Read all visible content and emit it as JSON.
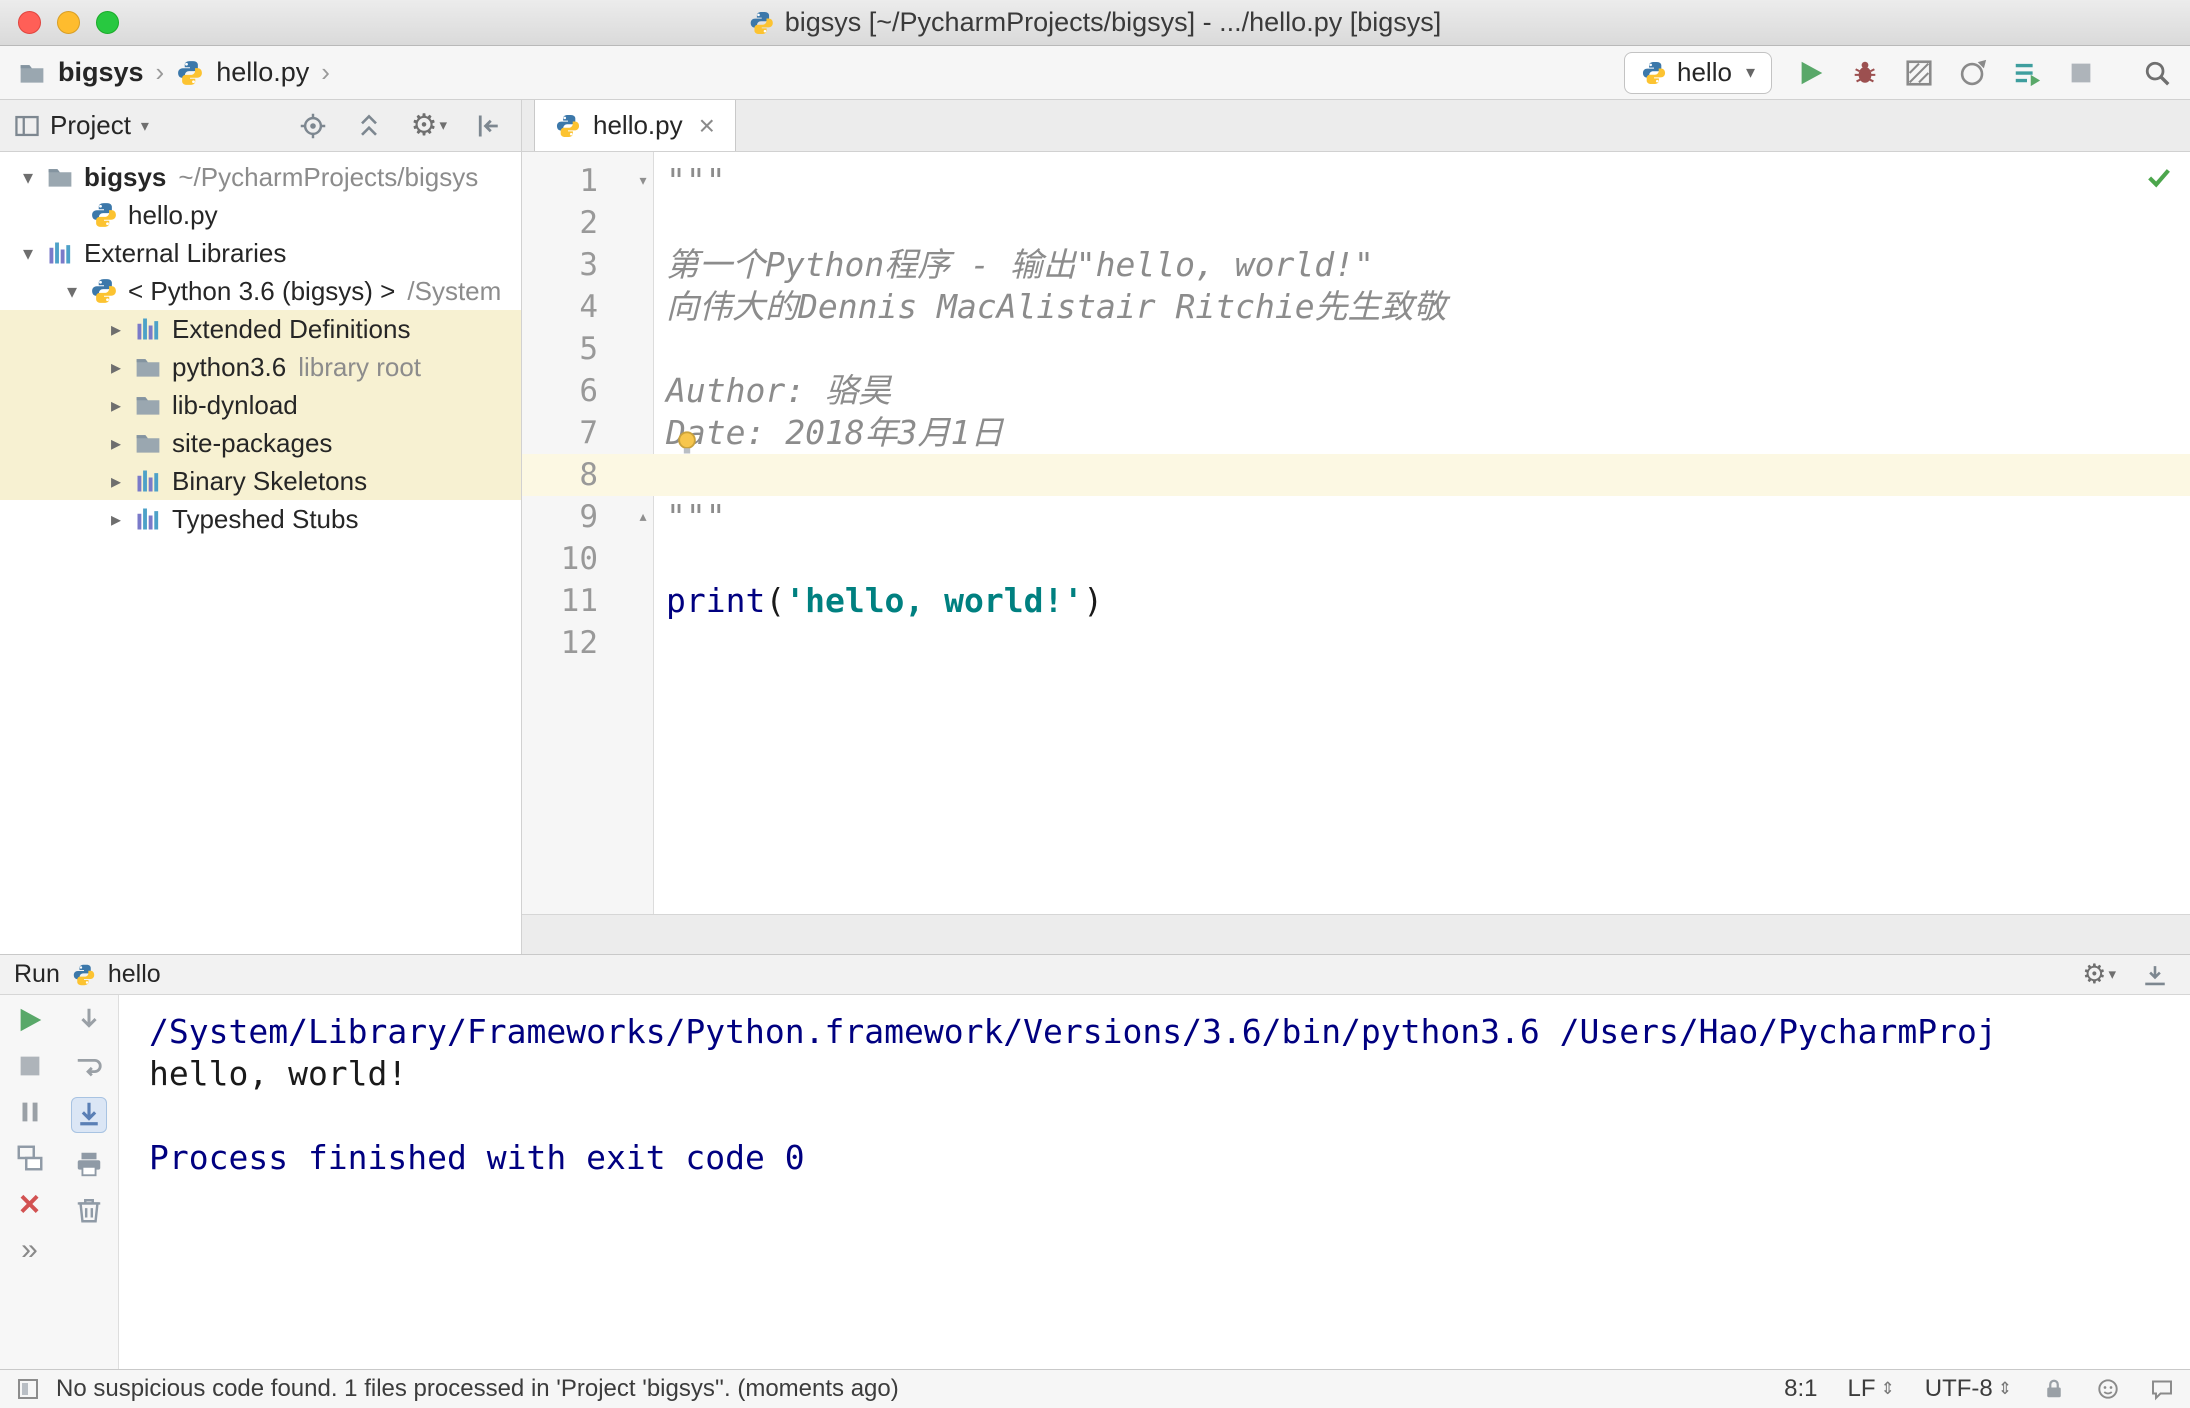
{
  "colors": {
    "run_green": "#59a869",
    "error_red": "#d25252",
    "library_highlight": "#f7f1d2",
    "caret_line": "#fcf8e3",
    "console_system": "#000080",
    "keyword": "#000080",
    "string": "#008080",
    "docstring": "#8c8c8c",
    "check_green": "#4ca64c"
  },
  "icons": {
    "gear": "⚙",
    "dropdown": "▾",
    "close": "×",
    "more": "»",
    "updown": "⇕"
  },
  "titlebar": {
    "title": "bigsys [~/PycharmProjects/bigsys] - .../hello.py [bigsys]"
  },
  "toolbar": {
    "breadcrumb": {
      "project": "bigsys",
      "file": "hello.py",
      "separator": "›"
    },
    "run_config": {
      "label": "hello",
      "dropdown_glyph": "▾"
    }
  },
  "project_panel": {
    "header": {
      "title": "Project",
      "dropdown_glyph": "▾"
    },
    "tree": [
      {
        "label": "bigsys",
        "suffix": "~/PycharmProjects/bigsys",
        "icon": "folder",
        "chevron": "down",
        "depth": 0,
        "bold": true
      },
      {
        "label": "hello.py",
        "icon": "py",
        "chevron": "none",
        "depth": 1
      },
      {
        "label": "External Libraries",
        "icon": "lib",
        "chevron": "down",
        "depth": 0
      },
      {
        "label": "< Python 3.6 (bigsys) >",
        "suffix": "/System",
        "icon": "py",
        "chevron": "down",
        "depth": 1
      },
      {
        "label": "Extended Definitions",
        "icon": "lib",
        "chevron": "right",
        "depth": 2,
        "highlight": true
      },
      {
        "label": "python3.6",
        "suffix": "library root",
        "icon": "folder",
        "chevron": "right",
        "depth": 2,
        "highlight": true
      },
      {
        "label": "lib-dynload",
        "icon": "folder",
        "chevron": "right",
        "depth": 2,
        "highlight": true
      },
      {
        "label": "site-packages",
        "icon": "folder",
        "chevron": "right",
        "depth": 2,
        "highlight": true
      },
      {
        "label": "Binary Skeletons",
        "icon": "lib",
        "chevron": "right",
        "depth": 2,
        "highlight": true
      },
      {
        "label": "Typeshed Stubs",
        "icon": "lib",
        "chevron": "right",
        "depth": 2
      }
    ]
  },
  "editor": {
    "tab": {
      "label": "hello.py",
      "close_glyph": "×"
    },
    "lines": [
      {
        "num": "1",
        "fold": "top",
        "segments": [
          {
            "text": "\"\"\"",
            "style": "doc"
          }
        ]
      },
      {
        "num": "2",
        "segments": []
      },
      {
        "num": "3",
        "segments": [
          {
            "text": "第一个Python程序 - 输出\"hello, world!\"",
            "style": "doc"
          }
        ]
      },
      {
        "num": "4",
        "segments": [
          {
            "text": "向伟大的Dennis MacAlistair Ritchie先生致敬",
            "style": "doc"
          }
        ]
      },
      {
        "num": "5",
        "segments": []
      },
      {
        "num": "6",
        "segments": [
          {
            "text": "Author: 骆昊",
            "style": "doc"
          }
        ]
      },
      {
        "num": "7",
        "segments": [
          {
            "text": "Date: 2018年3月1日",
            "style": "doc"
          }
        ]
      },
      {
        "num": "8",
        "caret": true,
        "segments": []
      },
      {
        "num": "9",
        "fold": "bottom",
        "segments": [
          {
            "text": "\"\"\"",
            "style": "doc"
          }
        ]
      },
      {
        "num": "10",
        "segments": []
      },
      {
        "num": "11",
        "segments": [
          {
            "text": "print",
            "style": "kw"
          },
          {
            "text": "(",
            "style": "plain"
          },
          {
            "text": "'hello, world!'",
            "style": "str"
          },
          {
            "text": ")",
            "style": "plain"
          }
        ]
      },
      {
        "num": "12",
        "segments": []
      }
    ]
  },
  "run_panel": {
    "title": "Run",
    "config": "hello",
    "console": [
      {
        "text": "/System/Library/Frameworks/Python.framework/Versions/3.6/bin/python3.6 /Users/Hao/PycharmProj",
        "style": "system"
      },
      {
        "text": "hello, world!",
        "style": "stdout"
      },
      {
        "text": "",
        "style": "stdout"
      },
      {
        "text": "Process finished with exit code 0",
        "style": "system"
      }
    ]
  },
  "statusbar": {
    "message": "No suspicious code found. 1 files processed in 'Project 'bigsys''. (moments ago)",
    "caret_position": "8:1",
    "line_separator": "LF",
    "encoding": "UTF-8"
  }
}
